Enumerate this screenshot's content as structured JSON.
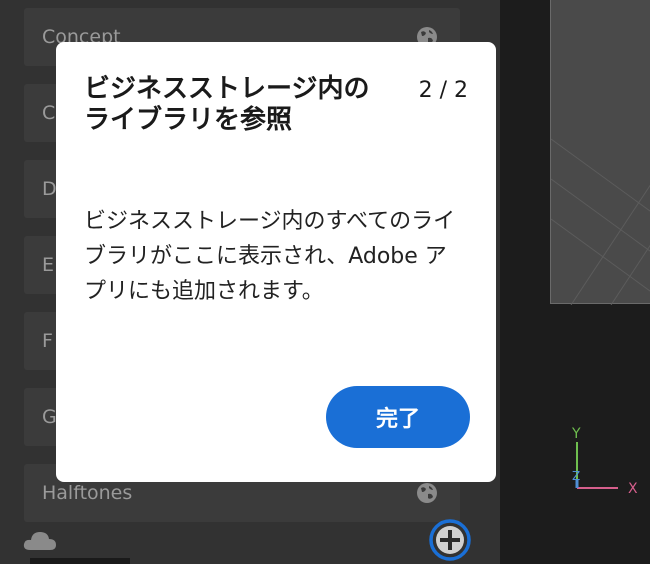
{
  "library_panel": {
    "items": [
      {
        "label": "Concept"
      },
      {
        "label": "C"
      },
      {
        "label": "D"
      },
      {
        "label": "E"
      },
      {
        "label": "F"
      },
      {
        "label": "G"
      },
      {
        "label": "Halftones"
      }
    ]
  },
  "viewport": {
    "axis_labels": {
      "y": "Y",
      "z": "Z",
      "x": "X"
    }
  },
  "tour_dialog": {
    "title": "ビジネスストレージ内のライブラリを参照",
    "step": "2 / 2",
    "body": "ビジネスストレージ内のすべてのライブラリがここに表示され、Adobe アプリにも追加されます。",
    "done_label": "完了"
  },
  "colors": {
    "accent": "#1a6fd6",
    "panel_bg": "#323232",
    "item_bg": "#3b3b3b"
  }
}
